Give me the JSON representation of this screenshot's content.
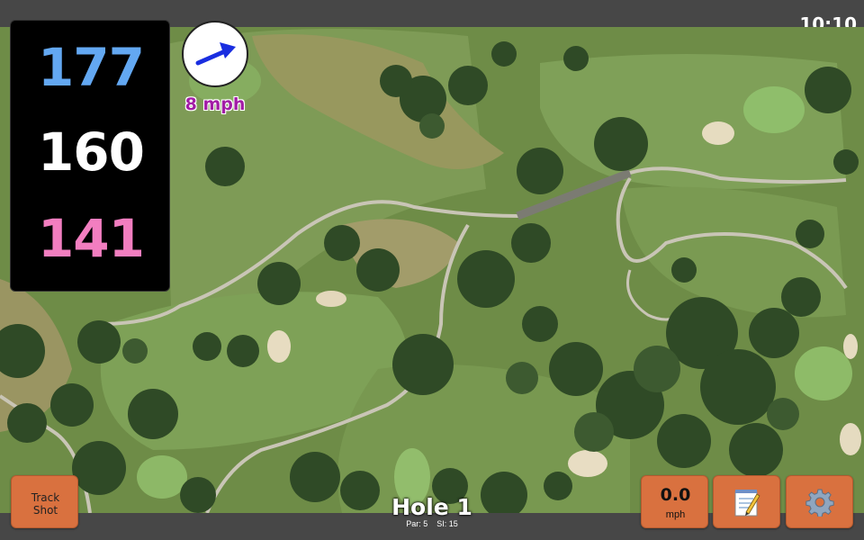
{
  "status_bar": {
    "time": "10:10"
  },
  "distances": {
    "back": "177",
    "center": "160",
    "front": "141",
    "colors": {
      "back": "#63a8f2",
      "center": "#ffffff",
      "front": "#f27ec0"
    }
  },
  "wind": {
    "speed": "8 mph",
    "arrow_color": "#1a2ee0",
    "direction": "northeast"
  },
  "buttons": {
    "track_shot": {
      "line1": "Track",
      "line2": "Shot"
    },
    "speed": {
      "value": "0.0",
      "unit": "mph"
    },
    "notes": {
      "icon": "notepad-icon"
    },
    "settings": {
      "icon": "gear-icon"
    }
  },
  "hole": {
    "title": "Hole 1",
    "par": "Par: 5",
    "stroke_index": "SI: 15"
  },
  "theme": {
    "button_color": "#d9713f",
    "bar_color": "#474747"
  }
}
